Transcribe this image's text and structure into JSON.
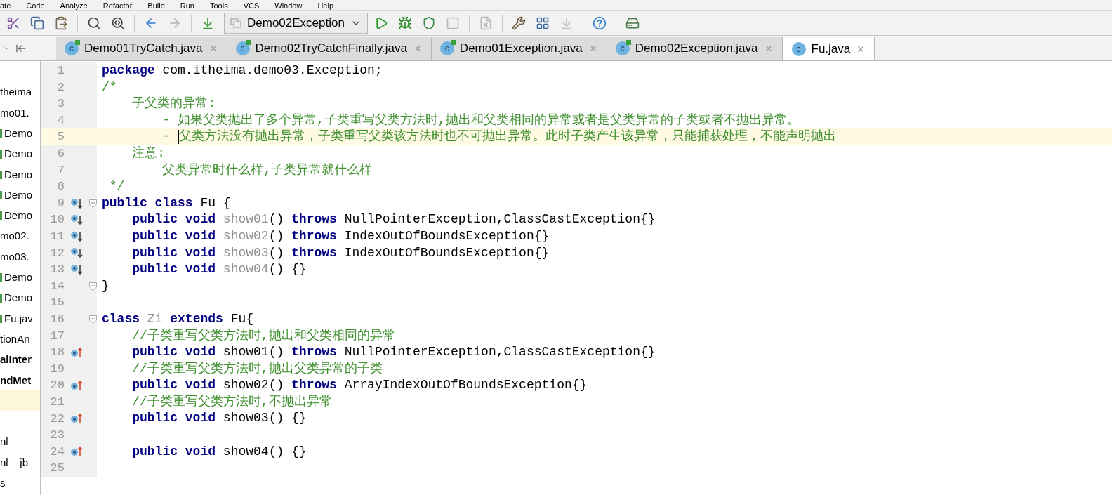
{
  "menu": [
    "ate",
    "Code",
    "Analyze",
    "Refactor",
    "Build",
    "Run",
    "Tools",
    "VCS",
    "Window",
    "Help"
  ],
  "toolbar": {
    "left": [
      {
        "kind": "cut"
      },
      {
        "kind": "copy"
      },
      {
        "kind": "paste"
      },
      {
        "kind": "separator"
      },
      {
        "kind": "find"
      },
      {
        "kind": "replace"
      },
      {
        "kind": "separator"
      },
      {
        "kind": "back"
      },
      {
        "kind": "forward"
      },
      {
        "kind": "separator"
      },
      {
        "kind": "build"
      }
    ],
    "run_config": "Demo02Exception",
    "right": [
      {
        "kind": "run"
      },
      {
        "kind": "debug"
      },
      {
        "kind": "coverage"
      },
      {
        "kind": "stop"
      },
      {
        "kind": "separator"
      },
      {
        "kind": "disabled"
      },
      {
        "kind": "separator"
      },
      {
        "kind": "wrench"
      },
      {
        "kind": "structure"
      },
      {
        "kind": "disabled2"
      },
      {
        "kind": "separator"
      },
      {
        "kind": "help"
      },
      {
        "kind": "separator"
      },
      {
        "kind": "sdk"
      }
    ]
  },
  "tabs": [
    {
      "label": "Demo01TryCatch.java",
      "icon_label": "c",
      "runnable": true,
      "selected": false
    },
    {
      "label": "Demo02TryCatchFinally.java",
      "icon_label": "c",
      "runnable": true,
      "selected": false
    },
    {
      "label": "Demo01Exception.java",
      "icon_label": "c",
      "runnable": true,
      "selected": false
    },
    {
      "label": "Demo02Exception.java",
      "icon_label": "c",
      "runnable": true,
      "selected": false
    },
    {
      "label": "Fu.java",
      "icon_label": "c",
      "runnable": false,
      "selected": true
    }
  ],
  "project_tree": [
    {
      "text": "theima",
      "kind": "plain",
      "selected": false
    },
    {
      "text": "mo01.",
      "kind": "plain",
      "selected": false
    },
    {
      "text": "Demo",
      "kind": "class",
      "selected": false
    },
    {
      "text": "Demo",
      "kind": "class",
      "selected": false
    },
    {
      "text": "Demo",
      "kind": "class",
      "selected": false
    },
    {
      "text": "Demo",
      "kind": "class",
      "selected": false
    },
    {
      "text": "Demo",
      "kind": "class",
      "selected": false
    },
    {
      "text": "mo02.",
      "kind": "plain",
      "selected": false
    },
    {
      "text": "mo03.",
      "kind": "plain",
      "selected": false
    },
    {
      "text": "Demo",
      "kind": "class",
      "selected": false
    },
    {
      "text": "Demo",
      "kind": "class",
      "selected": false
    },
    {
      "text": "Fu.jav",
      "kind": "class",
      "selected": false
    },
    {
      "text": "tionAn",
      "kind": "plain",
      "selected": false
    },
    {
      "text": "alInter",
      "kind": "bold",
      "selected": false
    },
    {
      "text": "ndMet",
      "kind": "bold",
      "selected": false
    },
    {
      "kind": "plain",
      "selected": true
    },
    {
      "kind": "plain",
      "selected": false
    },
    {
      "text": "nl",
      "kind": "plain",
      "selected": false
    },
    {
      "text": "nl__jb_",
      "kind": "plain",
      "selected": false
    },
    {
      "text": "s",
      "kind": "plain",
      "selected": false
    }
  ],
  "editor": {
    "lines": [
      {
        "number": "1",
        "tokens": [
          {
            "kind": "keyword",
            "text": "package"
          },
          {
            "kind": "plain",
            "text": " com.itheima.demo03.Exception;"
          }
        ]
      },
      {
        "number": "2",
        "tokens": [
          {
            "kind": "comment",
            "text": "/*"
          }
        ]
      },
      {
        "number": "3",
        "tokens": [
          {
            "kind": "comment",
            "text": "    子父类的异常:"
          }
        ]
      },
      {
        "number": "4",
        "tokens": [
          {
            "kind": "comment",
            "text": "        - 如果父类抛出了多个异常,子类重写父类方法时,抛出和父类相同的异常或者是父类异常的子类或者不抛出异常。"
          }
        ]
      },
      {
        "number": "5",
        "current": true,
        "tokens": [
          {
            "kind": "comment",
            "text": "        - "
          },
          {
            "kind": "cursor"
          },
          {
            "kind": "comment",
            "text": "父类方法没有抛出异常，子类重写父类该方法时也不可抛出异常。此时子类产生该异常，只能捕获处理，不能声明抛出"
          }
        ]
      },
      {
        "number": "6",
        "tokens": [
          {
            "kind": "comment",
            "text": "    注意:"
          }
        ]
      },
      {
        "number": "7",
        "tokens": [
          {
            "kind": "comment",
            "text": "        父类异常时什么样,子类异常就什么样"
          }
        ]
      },
      {
        "number": "8",
        "tokens": [
          {
            "kind": "comment",
            "text": " */"
          }
        ]
      },
      {
        "number": "9",
        "kind": "implemented",
        "fold": true,
        "tokens": [
          {
            "kind": "keyword",
            "text": "public class"
          },
          {
            "kind": "plain",
            "text": " Fu {"
          }
        ]
      },
      {
        "number": "10",
        "kind": "implemented",
        "tokens": [
          {
            "kind": "keyword",
            "text": "    public void"
          },
          {
            "kind": "unused",
            "text": " show01"
          },
          {
            "kind": "plain",
            "text": "() "
          },
          {
            "kind": "keyword",
            "text": "throws"
          },
          {
            "kind": "plain",
            "text": " NullPointerException,ClassCastException{}"
          }
        ]
      },
      {
        "number": "11",
        "kind": "implemented",
        "tokens": [
          {
            "kind": "keyword",
            "text": "    public void"
          },
          {
            "kind": "unused",
            "text": " show02"
          },
          {
            "kind": "plain",
            "text": "() "
          },
          {
            "kind": "keyword",
            "text": "throws"
          },
          {
            "kind": "plain",
            "text": " IndexOutOfBoundsException{}"
          }
        ]
      },
      {
        "number": "12",
        "kind": "implemented",
        "tokens": [
          {
            "kind": "keyword",
            "text": "    public void"
          },
          {
            "kind": "unused",
            "text": " show03"
          },
          {
            "kind": "plain",
            "text": "() "
          },
          {
            "kind": "keyword",
            "text": "throws"
          },
          {
            "kind": "plain",
            "text": " IndexOutOfBoundsException{}"
          }
        ]
      },
      {
        "number": "13",
        "kind": "implemented",
        "tokens": [
          {
            "kind": "keyword",
            "text": "    public void"
          },
          {
            "kind": "unused",
            "text": " show04"
          },
          {
            "kind": "plain",
            "text": "() {}"
          }
        ]
      },
      {
        "number": "14",
        "fold": true,
        "tokens": [
          {
            "kind": "plain",
            "text": "}"
          }
        ]
      },
      {
        "number": "15"
      },
      {
        "number": "16",
        "fold": true,
        "tokens": [
          {
            "kind": "keyword",
            "text": "class"
          },
          {
            "kind": "unused",
            "text": " Zi"
          },
          {
            "kind": "keyword",
            "text": " extends"
          },
          {
            "kind": "plain",
            "text": " Fu{"
          }
        ]
      },
      {
        "number": "17",
        "tokens": [
          {
            "kind": "comment",
            "text": "    //子类重写父类方法时,抛出和父类相同的异常"
          }
        ]
      },
      {
        "number": "18",
        "kind": "overrides",
        "tokens": [
          {
            "kind": "keyword",
            "text": "    public void"
          },
          {
            "kind": "plain",
            "text": " show01() "
          },
          {
            "kind": "keyword",
            "text": "throws"
          },
          {
            "kind": "plain",
            "text": " NullPointerException,ClassCastException{}"
          }
        ]
      },
      {
        "number": "19",
        "tokens": [
          {
            "kind": "comment",
            "text": "    //子类重写父类方法时,抛出父类异常的子类"
          }
        ]
      },
      {
        "number": "20",
        "kind": "overrides",
        "tokens": [
          {
            "kind": "keyword",
            "text": "    public void"
          },
          {
            "kind": "plain",
            "text": " show02() "
          },
          {
            "kind": "keyword",
            "text": "throws"
          },
          {
            "kind": "plain",
            "text": " ArrayIndexOutOfBoundsException{}"
          }
        ]
      },
      {
        "number": "21",
        "tokens": [
          {
            "kind": "comment",
            "text": "    //子类重写父类方法时,不抛出异常"
          }
        ]
      },
      {
        "number": "22",
        "kind": "overrides",
        "tokens": [
          {
            "kind": "keyword",
            "text": "    public void"
          },
          {
            "kind": "plain",
            "text": " show03() {}"
          }
        ]
      },
      {
        "number": "23"
      },
      {
        "number": "24",
        "kind": "overrides",
        "tokens": [
          {
            "kind": "keyword",
            "text": "    public void"
          },
          {
            "kind": "plain",
            "text": " show04() {}"
          }
        ]
      },
      {
        "number": "25"
      }
    ]
  }
}
